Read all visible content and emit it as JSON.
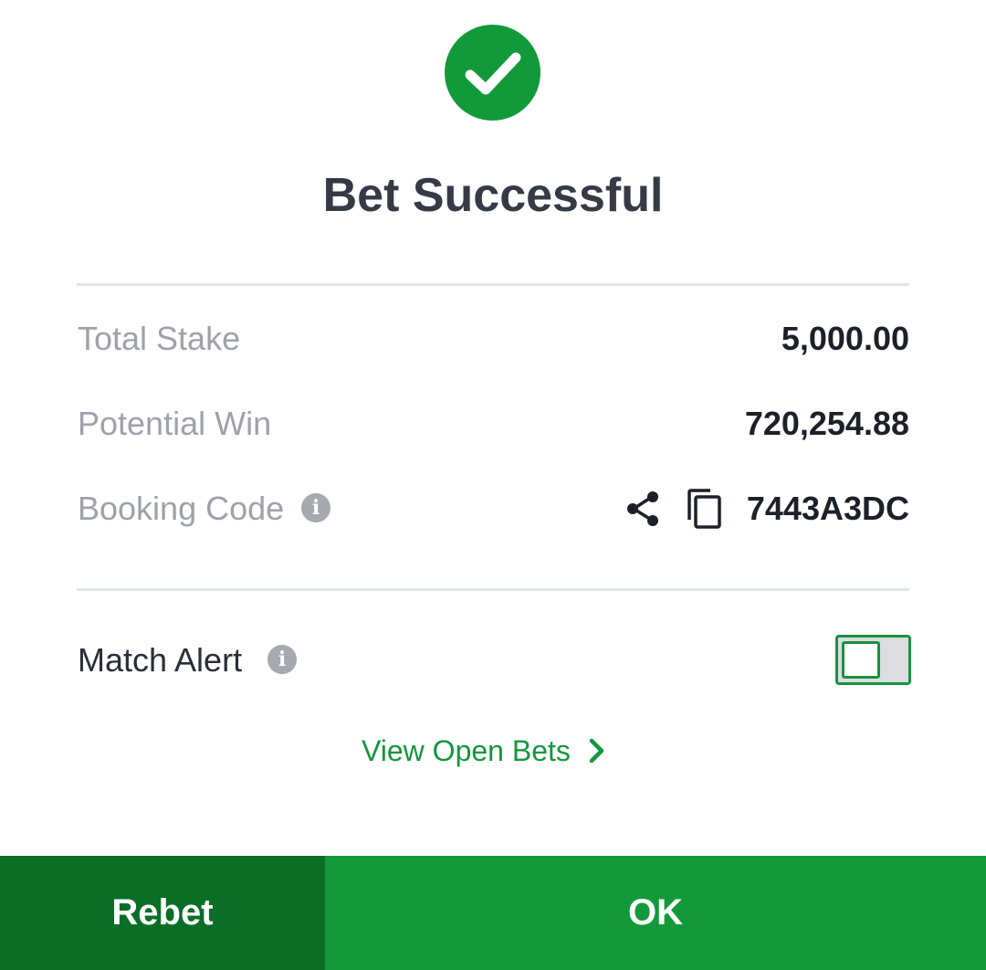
{
  "dialog": {
    "title": "Bet Successful",
    "success_icon": "check-circle-icon"
  },
  "summary": {
    "total_stake_label": "Total Stake",
    "total_stake_value": "5,000.00",
    "potential_win_label": "Potential Win",
    "potential_win_value": "720,254.88",
    "booking_code_label": "Booking Code",
    "booking_code_value": "7443A3DC"
  },
  "match_alert": {
    "label": "Match Alert",
    "enabled": false
  },
  "links": {
    "view_open_bets": "View Open Bets"
  },
  "buttons": {
    "rebet": "Rebet",
    "ok": "OK"
  },
  "colors": {
    "brand_green": "#13993a",
    "dark_green": "#0b6e27",
    "title_text": "#353a45",
    "label_grey": "#9ea1a9"
  }
}
